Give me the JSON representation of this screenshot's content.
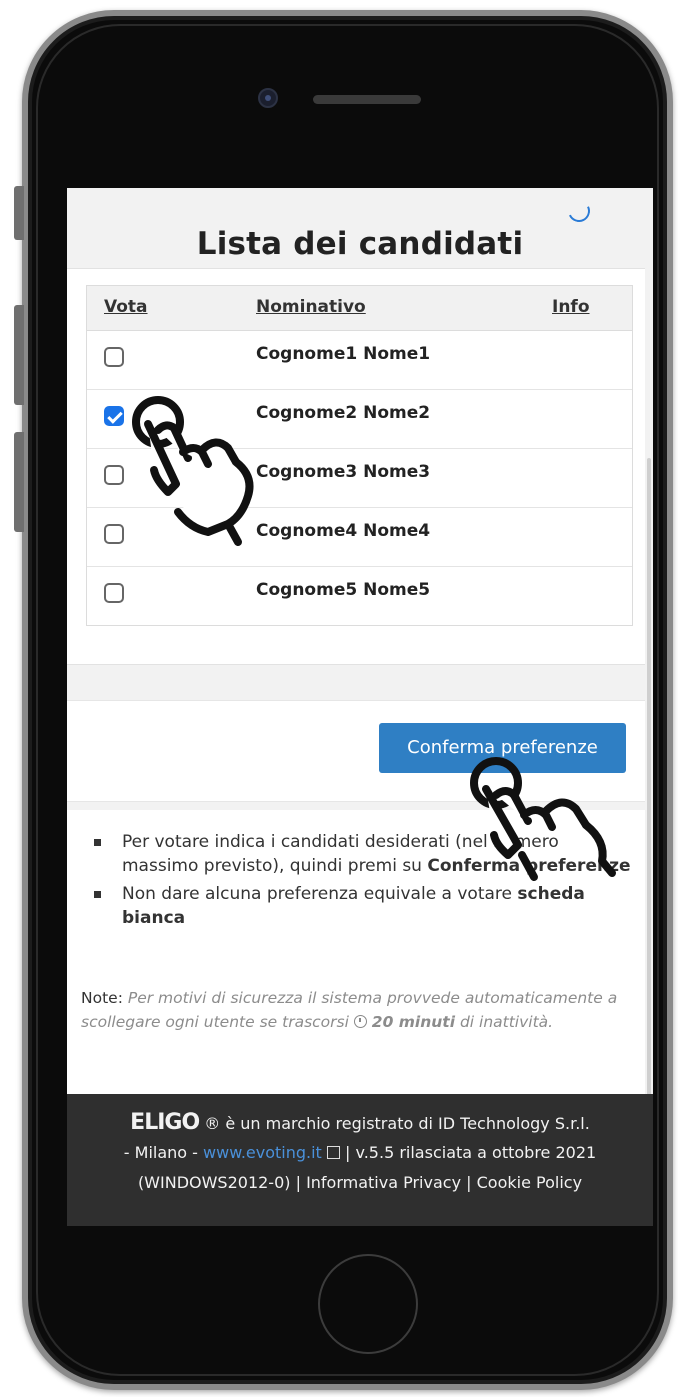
{
  "page": {
    "title": "Lista dei candidati"
  },
  "table": {
    "headers": {
      "vote": "Vota",
      "name": "Nominativo",
      "info": "Info"
    },
    "rows": [
      {
        "name": "Cognome1 Nome1",
        "checked": false
      },
      {
        "name": "Cognome2 Nome2",
        "checked": true
      },
      {
        "name": "Cognome3 Nome3",
        "checked": false
      },
      {
        "name": "Cognome4 Nome4",
        "checked": false
      },
      {
        "name": "Cognome5 Nome5",
        "checked": false
      }
    ]
  },
  "actions": {
    "confirm_label": "Conferma preferenze"
  },
  "instructions": {
    "item1_text": "Per votare indica i candidati desiderati (nel numero massimo previsto), quindi premi su",
    "item1_bold": "Conferma preferenze",
    "item2_text": "Non dare alcuna preferenza equivale a votare",
    "item2_bold": "scheda bianca"
  },
  "note": {
    "label": "Note:",
    "text_before": "Per motivi di sicurezza il sistema provvede automaticamente a scollegare ogni utente se trascorsi",
    "minutes": "20 minuti",
    "text_after": "di inattività."
  },
  "footer": {
    "logo": "ELIGO",
    "line1_rest": "® è un marchio registrato di ID Technology S.r.l.",
    "line2_prefix": "- Milano -",
    "link": "www.evoting.it",
    "line2_suffix": "| v.5.5 rilasciata a ottobre 2021",
    "line3_prefix": "(WINDOWS2012-0) |",
    "privacy": "Informativa Privacy",
    "separator": "|",
    "cookie": "Cookie Policy"
  },
  "colors": {
    "accent": "#2f7fc4",
    "checkbox_checked": "#1a73e8",
    "footer_bg": "#2f2f2f",
    "link": "#4a90d9"
  }
}
